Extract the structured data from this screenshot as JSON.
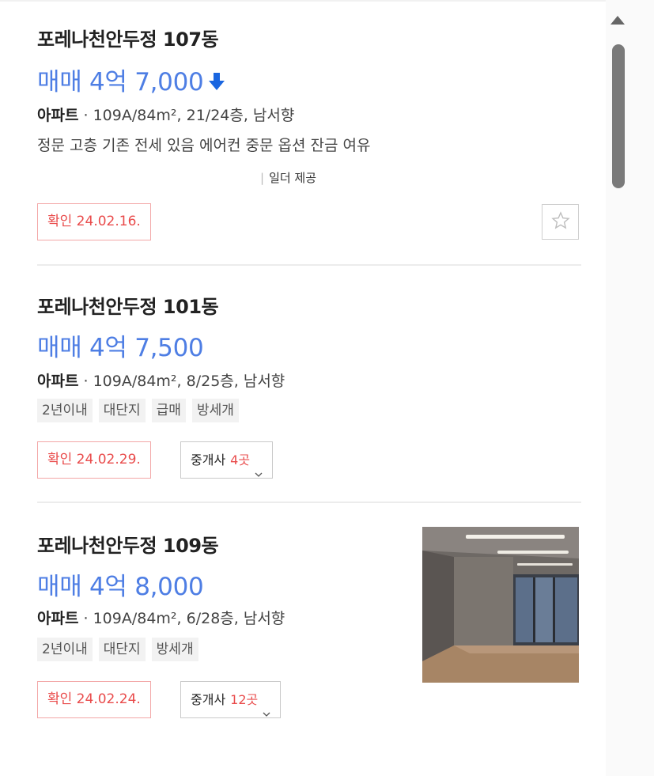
{
  "listings": [
    {
      "title": "포레나천안두정 107동",
      "price": "매매 4억 7,000",
      "price_change": "down-arrow-icon",
      "type": "아파트",
      "spec": "109A/84m², 21/24층, 남서향",
      "description": "정문 고층 기존 전세 있음 에어컨 중문 옵션 잔금 여유",
      "provider": "일더 제공",
      "confirmed": "확인 24.02.16.",
      "favorite_icon": "star-icon"
    },
    {
      "title": "포레나천안두정 101동",
      "price": "매매 4억 7,500",
      "type": "아파트",
      "spec": "109A/84m², 8/25층, 남서향",
      "tags": [
        "2년이내",
        "대단지",
        "급매",
        "방세개"
      ],
      "confirmed": "확인 24.02.29.",
      "agent_label": "중개사",
      "agent_count": "4곳"
    },
    {
      "title": "포레나천안두정 109동",
      "price": "매매 4억 8,000",
      "type": "아파트",
      "spec": "109A/84m², 6/28층, 남서향",
      "tags": [
        "2년이내",
        "대단지",
        "방세개"
      ],
      "confirmed": "확인 24.02.24.",
      "agent_label": "중개사",
      "agent_count": "12곳",
      "thumbnail": "room-photo"
    }
  ],
  "colors": {
    "price": "#4e7ee4",
    "confirm": "#e94b4b",
    "arrow": "#1a66e0"
  }
}
